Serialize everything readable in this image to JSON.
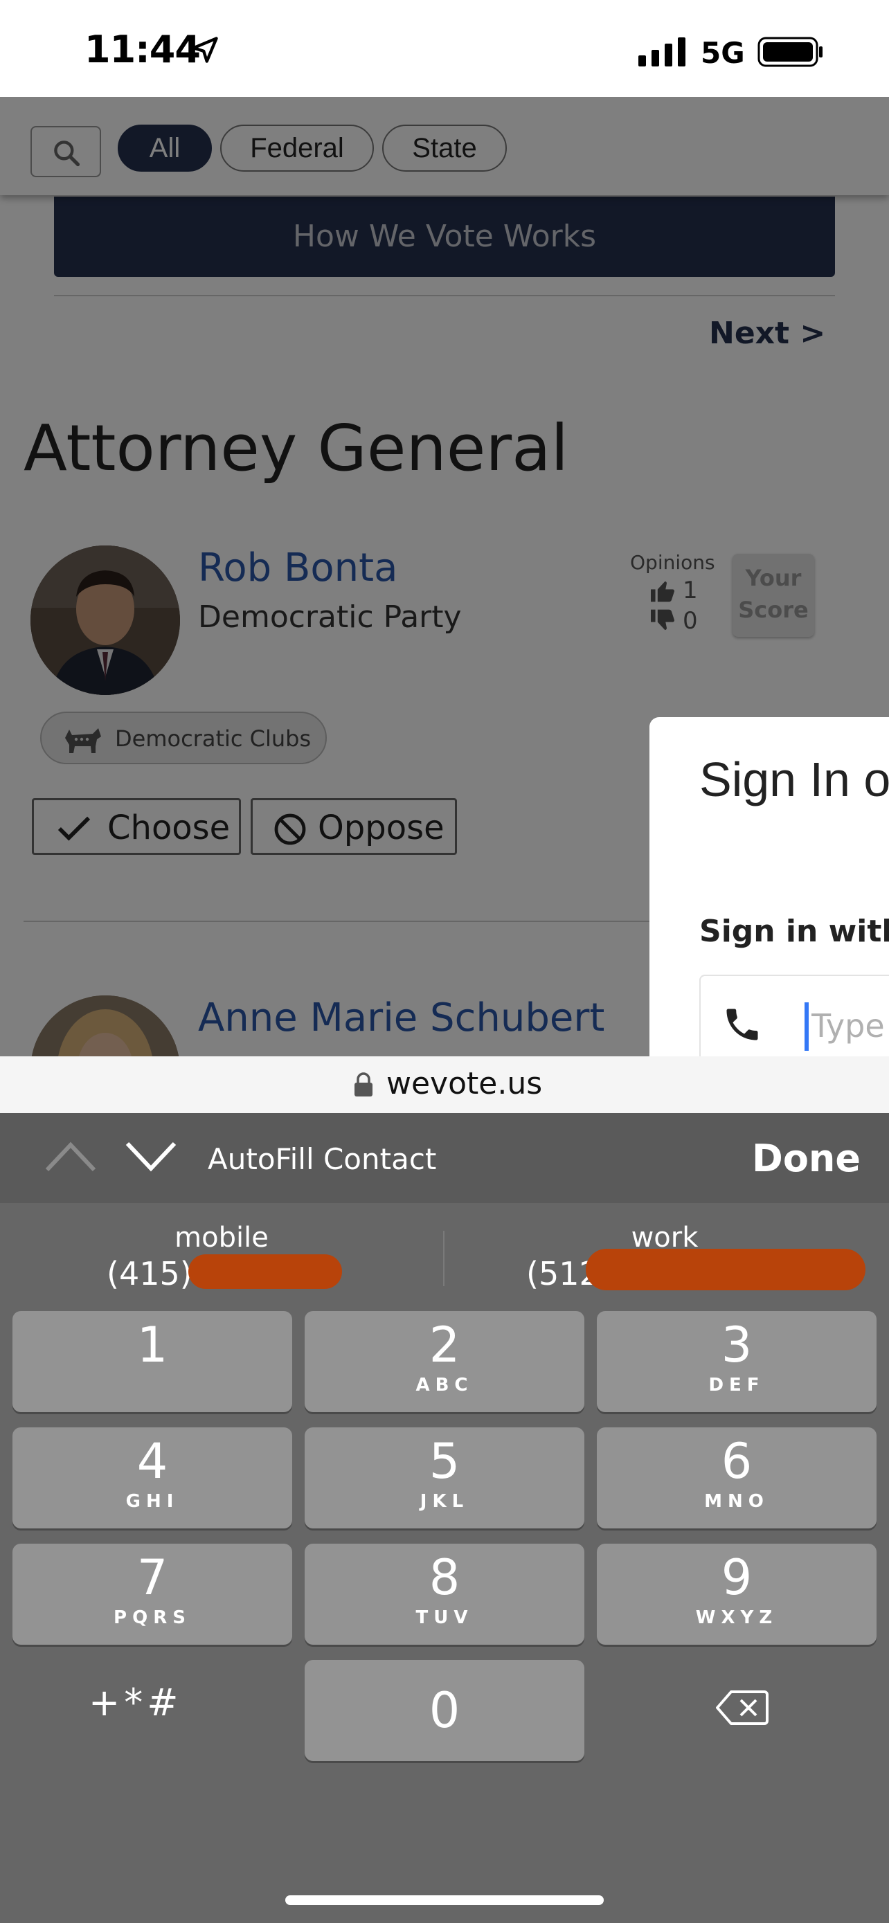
{
  "status_bar": {
    "time": "11:44",
    "network": "5G",
    "icons": [
      "location-arrow-icon",
      "signal-bars-icon",
      "battery-icon"
    ]
  },
  "filter": {
    "chips": [
      "All",
      "Federal",
      "State"
    ],
    "active": "All",
    "search_icon": "search-icon"
  },
  "banner": {
    "label": "How We Vote Works"
  },
  "nav": {
    "next_label": "Next >"
  },
  "office": {
    "title": "Attorney General"
  },
  "candidates": [
    {
      "name": "Rob Bonta",
      "party": "Democratic Party",
      "opinions_label": "Opinions",
      "support_count": "1",
      "oppose_count": "0",
      "score_label_1": "Your",
      "score_label_2": "Score",
      "endorsement": "Democratic Clubs"
    },
    {
      "name": "Anne Marie Schubert"
    }
  ],
  "actions": {
    "choose_label": "Choose",
    "oppose_label": "Oppose"
  },
  "dialog": {
    "title": "Sign In o",
    "subtitle": "Sign in with",
    "phone_placeholder": "Type p"
  },
  "browser": {
    "address": "wevote.us"
  },
  "keyboard_toolbar": {
    "autofill_label": "AutoFill Contact",
    "done_label": "Done"
  },
  "suggestions": [
    {
      "kind": "mobile",
      "number_prefix": "(415)"
    },
    {
      "kind": "work",
      "number_prefix": "(512)"
    }
  ],
  "keys": [
    {
      "digit": "1",
      "letters": ""
    },
    {
      "digit": "2",
      "letters": "ABC"
    },
    {
      "digit": "3",
      "letters": "DEF"
    },
    {
      "digit": "4",
      "letters": "GHI"
    },
    {
      "digit": "5",
      "letters": "JKL"
    },
    {
      "digit": "6",
      "letters": "MNO"
    },
    {
      "digit": "7",
      "letters": "PQRS"
    },
    {
      "digit": "8",
      "letters": "TUV"
    },
    {
      "digit": "9",
      "letters": "WXYZ"
    },
    {
      "digit": "0",
      "letters": ""
    }
  ],
  "symbols_label": "+*#",
  "colors": {
    "navy": "#24304f",
    "link_blue": "#2a56a8",
    "redaction": "#b8430a",
    "keyboard_bg": "#666666",
    "key_bg": "#939393"
  }
}
